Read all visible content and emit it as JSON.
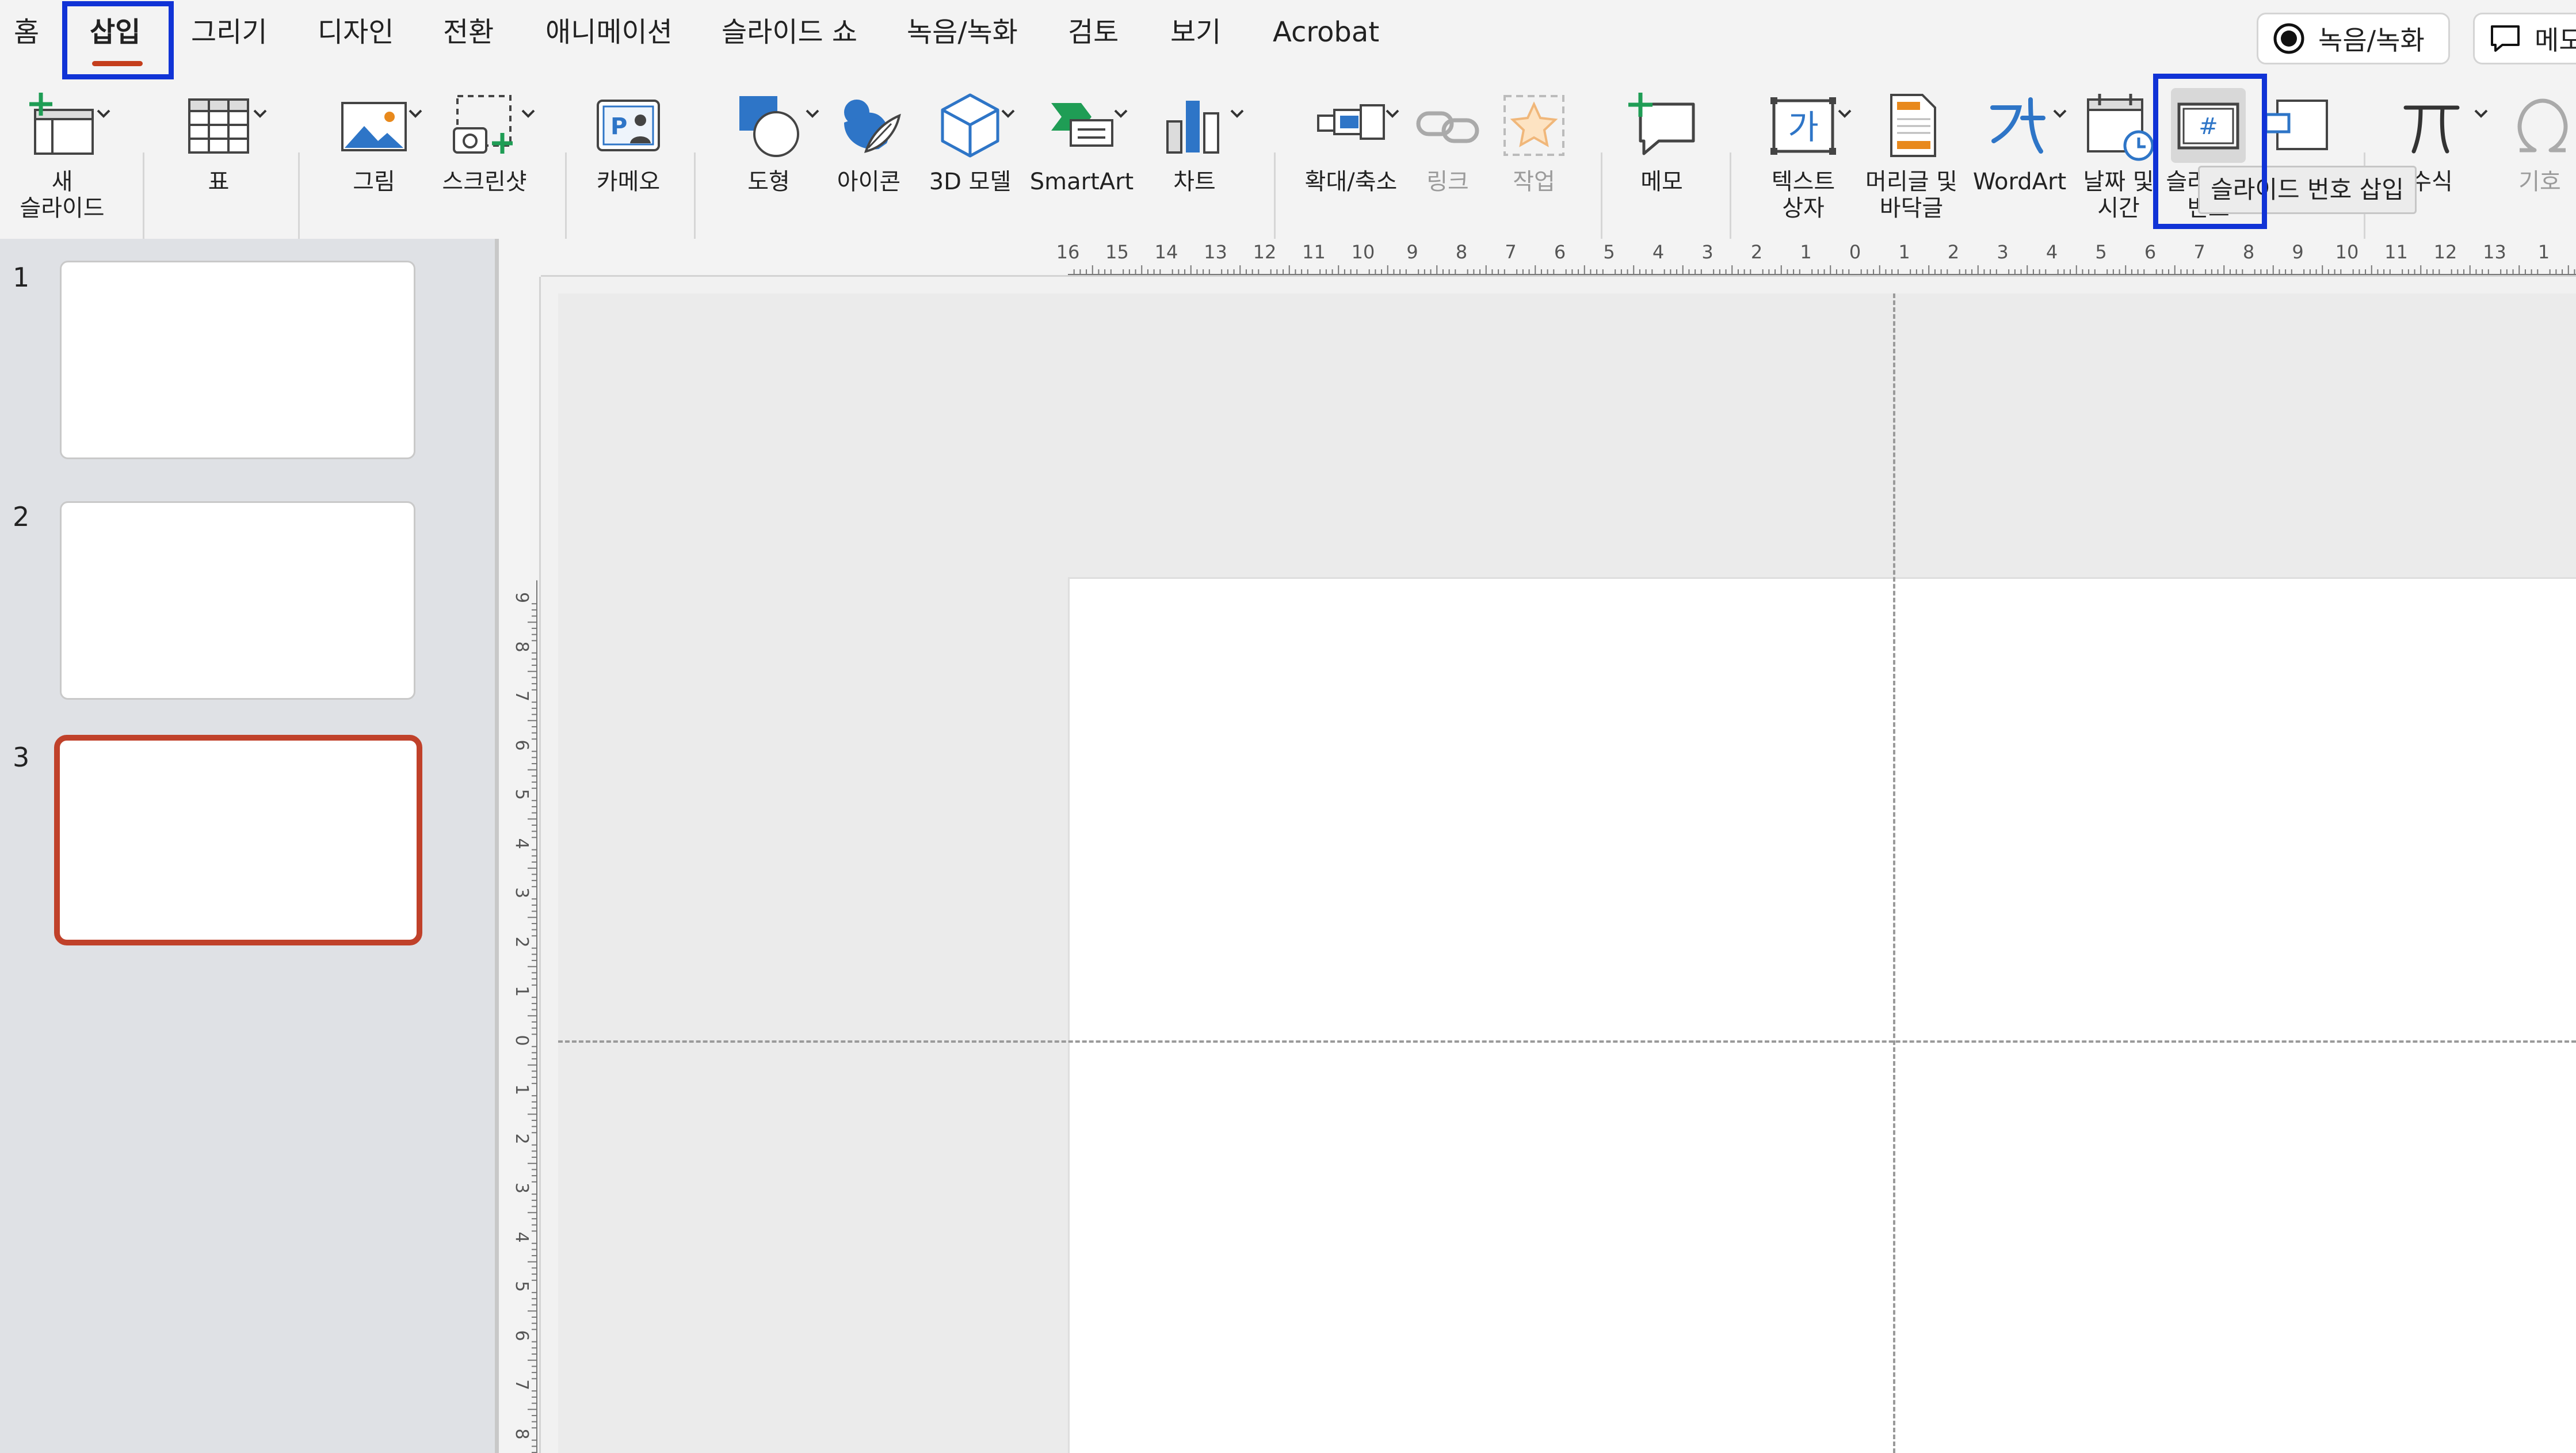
{
  "tabs": {
    "items": [
      {
        "label": "홈"
      },
      {
        "label": "삽입",
        "active": true
      },
      {
        "label": "그리기"
      },
      {
        "label": "디자인"
      },
      {
        "label": "전환"
      },
      {
        "label": "애니메이션"
      },
      {
        "label": "슬라이드 쇼"
      },
      {
        "label": "녹음/녹화"
      },
      {
        "label": "검토"
      },
      {
        "label": "보기"
      },
      {
        "label": "Acrobat"
      }
    ],
    "record_button": "녹음/녹화",
    "comment_button": "메모"
  },
  "ribbon": {
    "new_slide": "새\n슬라이드",
    "table": "표",
    "picture": "그림",
    "screenshot": "스크린샷",
    "cameo": "카메오",
    "shapes": "도형",
    "icons": "아이콘",
    "model3d": "3D 모델",
    "smartart": "SmartArt",
    "chart": "차트",
    "zoom": "확대/축소",
    "link": "링크",
    "action": "작업",
    "comment": "메모",
    "textbox": "텍스트\n상자",
    "header_footer": "머리글 및\n바닥글",
    "wordart": "WordArt",
    "date_time": "날짜 및\n시간",
    "slide_number": "슬라이드\n번호",
    "equation": "수식",
    "symbol": "기호",
    "textbox_glyph": "가",
    "slide_number_glyph": "#"
  },
  "tooltip": "슬라이드 번호 삽입",
  "thumbnails": {
    "items": [
      {
        "number": "1"
      },
      {
        "number": "2"
      },
      {
        "number": "3",
        "selected": true
      }
    ]
  },
  "ruler": {
    "horizontal_labels": [
      "16",
      "15",
      "14",
      "13",
      "12",
      "11",
      "10",
      "9",
      "8",
      "7",
      "6",
      "5",
      "4",
      "3",
      "2",
      "1",
      "0",
      "1",
      "2",
      "3",
      "4",
      "5",
      "6",
      "7",
      "8",
      "9",
      "10",
      "11",
      "12",
      "13",
      "1"
    ],
    "vertical_labels": [
      "9",
      "8",
      "7",
      "6",
      "5",
      "4",
      "3",
      "2",
      "1",
      "0",
      "1",
      "2",
      "3",
      "4",
      "5",
      "6",
      "7",
      "8"
    ]
  },
  "colors": {
    "active_tab_underline": "#c43e1c",
    "highlight_box": "#1033d6",
    "selected_thumbnail": "#c0412a",
    "icon_blue": "#2e75c7",
    "icon_green": "#1f9d55",
    "icon_orange": "#e8891c"
  }
}
